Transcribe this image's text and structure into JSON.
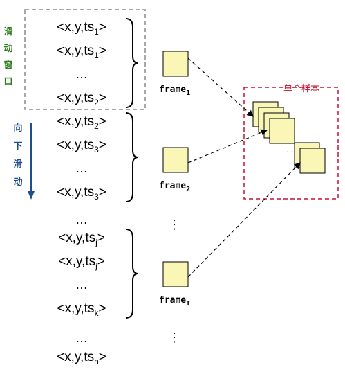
{
  "colors": {
    "frame_fill": "#f9f6b6",
    "frame_stroke": "#000000",
    "window_border": "#8c8c8c",
    "sample_border": "#c8102e",
    "sliding_window_text": "#2e7d1e",
    "slide_down_text": "#1f4e8c",
    "arrow": "#1f4e8c"
  },
  "sliding_window_label": [
    "滑",
    "动",
    "窗",
    "口"
  ],
  "slide_down_label": [
    "向",
    "下",
    "滑",
    "动"
  ],
  "sample_box_label": "单个样本",
  "event_prefix": "<x,y,ts",
  "event_suffix": ">",
  "ellipsis": "…",
  "vertical_ellipsis": "⋮",
  "frame_word": "frame",
  "groups": [
    {
      "events": [
        {
          "sub": "1",
          "kind": "event"
        },
        {
          "sub": "1",
          "kind": "event"
        },
        {
          "kind": "ellipsis"
        },
        {
          "sub": "2",
          "kind": "event"
        }
      ],
      "frame_sub": "1"
    },
    {
      "events": [
        {
          "sub": "2",
          "kind": "event"
        },
        {
          "sub": "3",
          "kind": "event"
        },
        {
          "kind": "ellipsis"
        },
        {
          "sub": "3",
          "kind": "event"
        }
      ],
      "frame_sub": "2"
    },
    {
      "events": [
        {
          "sub": "j",
          "kind": "event"
        },
        {
          "sub": "j",
          "kind": "event"
        },
        {
          "kind": "ellipsis"
        },
        {
          "sub": "k",
          "kind": "event"
        }
      ],
      "frame_sub": "T"
    }
  ],
  "tail_events": [
    {
      "sub": "n",
      "kind": "event"
    }
  ]
}
